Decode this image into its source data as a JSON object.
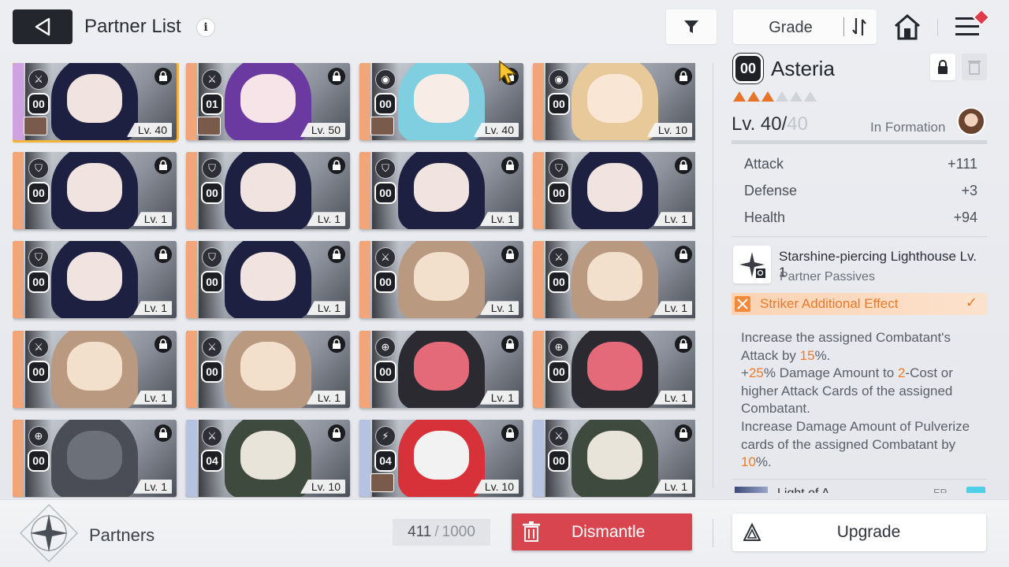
{
  "header": {
    "title": "Partner List",
    "info_symbol": "i",
    "sort_label": "Grade"
  },
  "colors": {
    "accent_orange": "#f07a2a",
    "dismantle_red": "#d9454f",
    "selected_outline": "#f2b43a",
    "dark": "#23262d"
  },
  "grid": {
    "cards": [
      {
        "cls": "sword",
        "lvl_badge": "00",
        "level": "Lv. 40",
        "selected": true,
        "locked": true,
        "hair": "#1d2040",
        "face": "#f1e3e0",
        "stripe": "#cfa3e0",
        "avatar": true
      },
      {
        "cls": "sword",
        "lvl_badge": "01",
        "level": "Lv. 50",
        "locked": true,
        "hair": "#6a3aa0",
        "face": "#f6e4e8",
        "stripe": "#f3a57a",
        "avatar": true
      },
      {
        "cls": "orb",
        "lvl_badge": "00",
        "level": "Lv. 40",
        "locked": true,
        "hair": "#7fcfe0",
        "face": "#f7ece6",
        "stripe": "#f3a57a",
        "avatar": true
      },
      {
        "cls": "orb",
        "lvl_badge": "00",
        "level": "Lv. 10",
        "locked": true,
        "hair": "#e8c99a",
        "face": "#f9e6d4",
        "stripe": "#f3a57a"
      },
      {
        "cls": "shield",
        "lvl_badge": "00",
        "level": "Lv. 1",
        "locked": true,
        "hair": "#1d2040",
        "face": "#f1e3e0",
        "stripe": "#f3a57a"
      },
      {
        "cls": "shield",
        "lvl_badge": "00",
        "level": "Lv. 1",
        "locked": true,
        "hair": "#1d2040",
        "face": "#f1e3e0",
        "stripe": "#f3a57a"
      },
      {
        "cls": "shield",
        "lvl_badge": "00",
        "level": "Lv. 1",
        "locked": true,
        "hair": "#1d2040",
        "face": "#f1e3e0",
        "stripe": "#f3a57a"
      },
      {
        "cls": "shield",
        "lvl_badge": "00",
        "level": "Lv. 1",
        "locked": true,
        "hair": "#1d2040",
        "face": "#f1e3e0",
        "stripe": "#f3a57a"
      },
      {
        "cls": "shield",
        "lvl_badge": "00",
        "level": "Lv. 1",
        "locked": true,
        "hair": "#1d2040",
        "face": "#f1e3e0",
        "stripe": "#f3a57a"
      },
      {
        "cls": "shield",
        "lvl_badge": "00",
        "level": "Lv. 1",
        "locked": true,
        "hair": "#1d2040",
        "face": "#f1e3e0",
        "stripe": "#f3a57a"
      },
      {
        "cls": "sword",
        "lvl_badge": "00",
        "level": "Lv. 1",
        "locked": true,
        "hair": "#b99a80",
        "face": "#f3e0cc",
        "stripe": "#f3a57a"
      },
      {
        "cls": "sword",
        "lvl_badge": "00",
        "level": "Lv. 1",
        "locked": true,
        "hair": "#b99a80",
        "face": "#f3e0cc",
        "stripe": "#f3a57a"
      },
      {
        "cls": "sword",
        "lvl_badge": "00",
        "level": "Lv. 1",
        "locked": true,
        "hair": "#b99a80",
        "face": "#f3e0cc",
        "stripe": "#f3a57a"
      },
      {
        "cls": "sword",
        "lvl_badge": "00",
        "level": "Lv. 1",
        "locked": true,
        "hair": "#b99a80",
        "face": "#f3e0cc",
        "stripe": "#f3a57a"
      },
      {
        "cls": "target",
        "lvl_badge": "00",
        "level": "Lv. 1",
        "locked": true,
        "hair": "#2b2a30",
        "face": "#e46a7a",
        "stripe": "#f3a57a"
      },
      {
        "cls": "target",
        "lvl_badge": "00",
        "level": "Lv. 1",
        "locked": true,
        "hair": "#2b2a30",
        "face": "#e46a7a",
        "stripe": "#f3a57a"
      },
      {
        "cls": "target",
        "lvl_badge": "00",
        "level": "Lv. 1",
        "locked": true,
        "hair": "#4a4d55",
        "face": "#6c7078",
        "stripe": "#f3a57a"
      },
      {
        "cls": "sword",
        "lvl_badge": "04",
        "level": "Lv. 10",
        "locked": true,
        "hair": "#3f4a3e",
        "face": "#e9e4da",
        "stripe": "#b6c3e0"
      },
      {
        "cls": "bolt",
        "lvl_badge": "04",
        "level": "Lv. 10",
        "locked": true,
        "hair": "#d7323a",
        "face": "#f2f2f2",
        "stripe": "#b6c3e0",
        "avatar": true
      },
      {
        "cls": "sword",
        "lvl_badge": "00",
        "level": "Lv. 1",
        "locked": true,
        "hair": "#3f4a3e",
        "face": "#e9e4da",
        "stripe": "#b6c3e0"
      }
    ]
  },
  "details": {
    "level_badge": "00",
    "name": "Asteria",
    "stars_filled": 3,
    "stars_total": 6,
    "level_current": "Lv. 40/",
    "level_max": "40",
    "formation_label": "In Formation",
    "stats": [
      {
        "label": "Attack",
        "value": "+111"
      },
      {
        "label": "Defense",
        "value": "+3"
      },
      {
        "label": "Health",
        "value": "+94"
      }
    ],
    "skill_name": "Starshine-piercing Lighthouse Lv. 1",
    "skill_type": "Partner Passives",
    "effect_label": "Striker Additional Effect",
    "desc": {
      "p1": "Increase the assigned Combatant's Attack by ",
      "v1": "15",
      "p2": "%.",
      "p3": "+",
      "v2": "25",
      "p4": "% Damage Amount to ",
      "v3": "2",
      "p5": "-Cost or higher Attack Cards of the assigned Combatant.",
      "p6": "Increase Damage Amount of Pulverize cards of the assigned Combatant by ",
      "v4": "10",
      "p7": "%."
    },
    "next_name": "Light of A...",
    "next_tag": "EP"
  },
  "bottom": {
    "label": "Partners",
    "count": "411",
    "count_sep": "/",
    "count_max": "1000",
    "dismantle": "Dismantle",
    "upgrade": "Upgrade"
  }
}
